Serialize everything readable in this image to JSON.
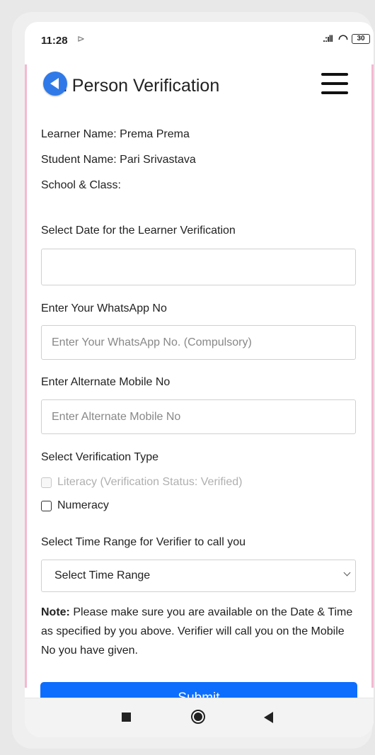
{
  "status": {
    "time": "11:28",
    "battery": "30"
  },
  "header": {
    "title": "In Person Verification"
  },
  "info": {
    "learner": "Learner Name: Prema Prema",
    "student": "Student Name: Pari Srivastava",
    "school": "School & Class:"
  },
  "form": {
    "date_label": "Select Date for the Learner Verification",
    "date_value": "",
    "whatsapp_label": "Enter Your WhatsApp No",
    "whatsapp_placeholder": "Enter Your WhatsApp No. (Compulsory)",
    "alternate_label": "Enter Alternate Mobile No",
    "alternate_placeholder": "Enter Alternate Mobile No",
    "verification_label": "Select Verification Type",
    "options": [
      {
        "label": "Literacy (Verification Status: Verified)",
        "disabled": true,
        "checked": false
      },
      {
        "label": "Numeracy",
        "disabled": false,
        "checked": false
      }
    ],
    "time_range_label": "Select Time Range for Verifier to call you",
    "time_range_selected": "Select Time Range"
  },
  "note": {
    "prefix": "Note:",
    "text": " Please make sure you are available on the Date & Time as specified by you above. Verifier will call you on the Mobile No you have given."
  },
  "submit_label": "Submit",
  "icons": {
    "back": "back-arrow-icon",
    "menu": "hamburger-menu-icon",
    "cast": "cast-icon",
    "signal": "signal-icon",
    "wifi": "wifi-icon",
    "battery": "battery-icon"
  },
  "colors": {
    "primary": "#0d6efd",
    "back_button": "#2f7ae8",
    "accent_border": "#f5b8cf"
  }
}
